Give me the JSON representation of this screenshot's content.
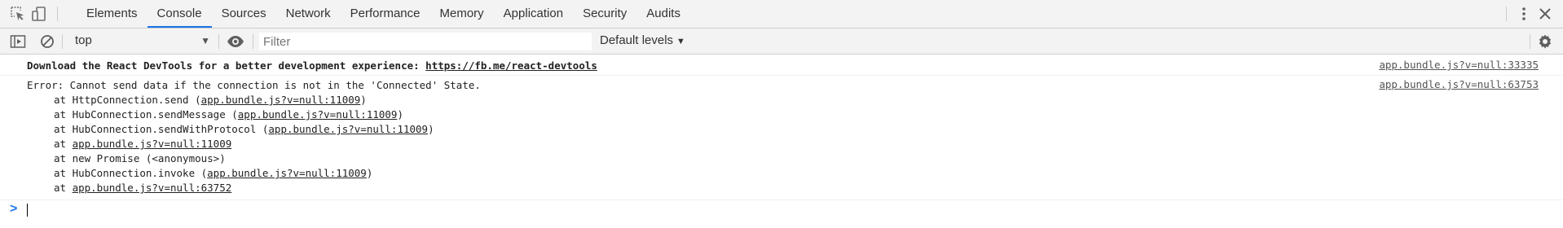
{
  "tabs": [
    {
      "label": "Elements",
      "active": false
    },
    {
      "label": "Console",
      "active": true
    },
    {
      "label": "Sources",
      "active": false
    },
    {
      "label": "Network",
      "active": false
    },
    {
      "label": "Performance",
      "active": false
    },
    {
      "label": "Memory",
      "active": false
    },
    {
      "label": "Application",
      "active": false
    },
    {
      "label": "Security",
      "active": false
    },
    {
      "label": "Audits",
      "active": false
    }
  ],
  "icons": {
    "inspect": "inspect-element-icon",
    "device": "device-toolbar-icon",
    "more": "more-vertical-icon",
    "close": "close-icon",
    "sidebar": "sidebar-toggle-icon",
    "clear": "clear-console-icon",
    "eye": "live-expression-icon",
    "settings": "gear-icon"
  },
  "toolbar": {
    "context": "top",
    "filter_placeholder": "Filter",
    "levels": "Default levels"
  },
  "messages": [
    {
      "text": "Download the React DevTools for a better development experience: ",
      "link": "https://fb.me/react-devtools",
      "source": "app.bundle.js?v=null:33335"
    },
    {
      "error": "Error: Cannot send data if the connection is not in the 'Connected' State.",
      "source": "app.bundle.js?v=null:63753",
      "stack": [
        {
          "pre": "at HttpConnection.send (",
          "link": "app.bundle.js?v=null:11009",
          "post": ")"
        },
        {
          "pre": "at HubConnection.sendMessage (",
          "link": "app.bundle.js?v=null:11009",
          "post": ")"
        },
        {
          "pre": "at HubConnection.sendWithProtocol (",
          "link": "app.bundle.js?v=null:11009",
          "post": ")"
        },
        {
          "pre": "at ",
          "link": "app.bundle.js?v=null:11009",
          "post": ""
        },
        {
          "pre": "at new Promise (<anonymous>)",
          "link": "",
          "post": ""
        },
        {
          "pre": "at HubConnection.invoke (",
          "link": "app.bundle.js?v=null:11009",
          "post": ")"
        },
        {
          "pre": "at ",
          "link": "app.bundle.js?v=null:63752",
          "post": ""
        }
      ]
    }
  ],
  "prompt": ">"
}
